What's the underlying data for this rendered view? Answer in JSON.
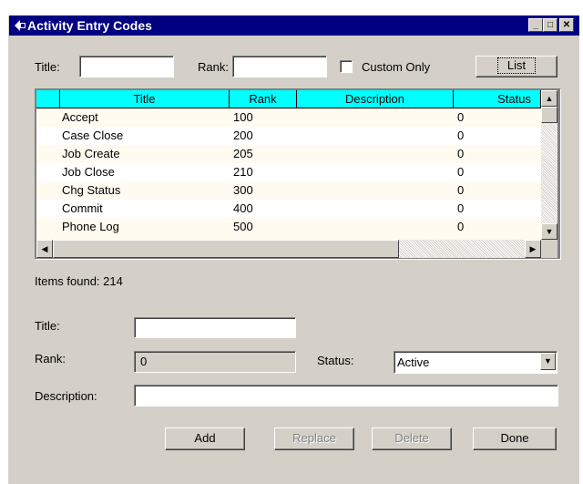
{
  "window": {
    "title": "Activity Entry Codes",
    "controls": {
      "minimize": "_",
      "maximize": "□",
      "close": "✕"
    }
  },
  "filter": {
    "title_label": "Title:",
    "title_value": "",
    "rank_label": "Rank:",
    "rank_value": "",
    "custom_only_label": "Custom Only",
    "custom_only_checked": false,
    "list_button": "List"
  },
  "grid": {
    "columns": [
      "Title",
      "Rank",
      "Description",
      "Status"
    ],
    "rows": [
      {
        "title": "Accept",
        "rank": "100",
        "description": "",
        "status": "0"
      },
      {
        "title": "Case Close",
        "rank": "200",
        "description": "",
        "status": "0"
      },
      {
        "title": "Job Create",
        "rank": "205",
        "description": "",
        "status": "0"
      },
      {
        "title": "Job Close",
        "rank": "210",
        "description": "",
        "status": "0"
      },
      {
        "title": "Chg Status",
        "rank": "300",
        "description": "",
        "status": "0"
      },
      {
        "title": "Commit",
        "rank": "400",
        "description": "",
        "status": "0"
      },
      {
        "title": "Phone Log",
        "rank": "500",
        "description": "",
        "status": "0"
      }
    ],
    "row_colors": [
      "#fffbf0",
      "#ffffff"
    ],
    "header_color": "#00ffff"
  },
  "items_found": "Items found: 214",
  "detail": {
    "title_label": "Title:",
    "title_value": "",
    "rank_label": "Rank:",
    "rank_value": "0",
    "status_label": "Status:",
    "status_value": "Active",
    "description_label": "Description:",
    "description_value": ""
  },
  "buttons": {
    "add": "Add",
    "replace": "Replace",
    "delete": "Delete",
    "done": "Done"
  },
  "icons": [
    "app-icon",
    "minimize-icon",
    "maximize-icon",
    "close-icon",
    "scroll-up-icon",
    "scroll-down-icon",
    "scroll-left-icon",
    "scroll-right-icon",
    "dropdown-arrow-icon"
  ]
}
